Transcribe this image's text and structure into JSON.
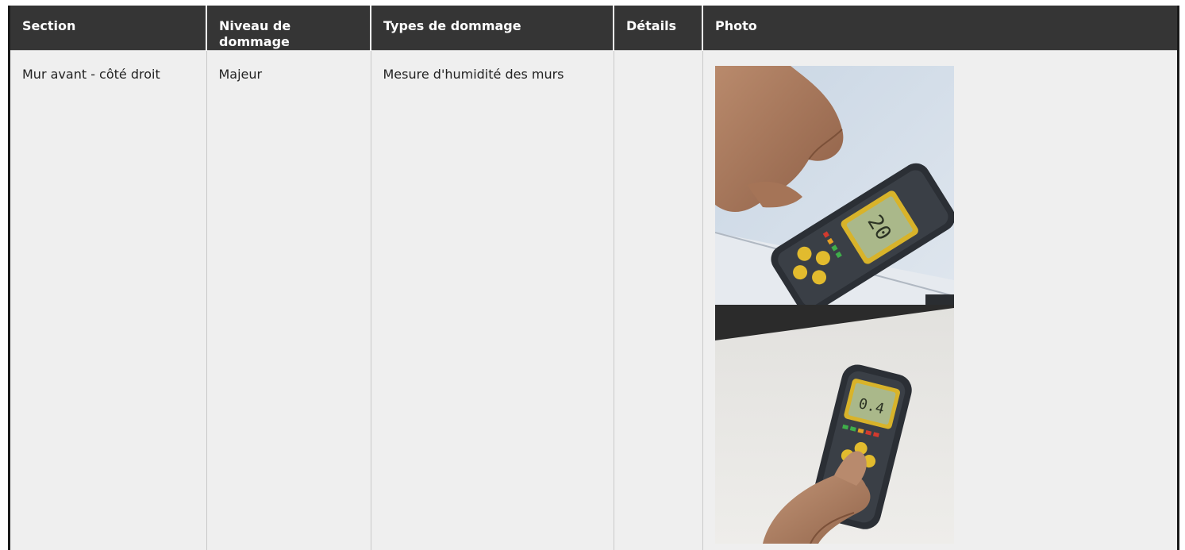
{
  "table": {
    "headers": [
      "Section",
      "Niveau de dommage",
      "Types de dommage",
      "Détails",
      "Photo"
    ],
    "rows": [
      {
        "section": "Mur avant - côté droit",
        "niveau": "Majeur",
        "types": "Mesure d'humidité des murs",
        "details": "",
        "photos": [
          {
            "subject": "moisture-meter-photo",
            "display": "20"
          },
          {
            "subject": "moisture-meter-photo",
            "display": "0.4"
          }
        ]
      }
    ]
  }
}
